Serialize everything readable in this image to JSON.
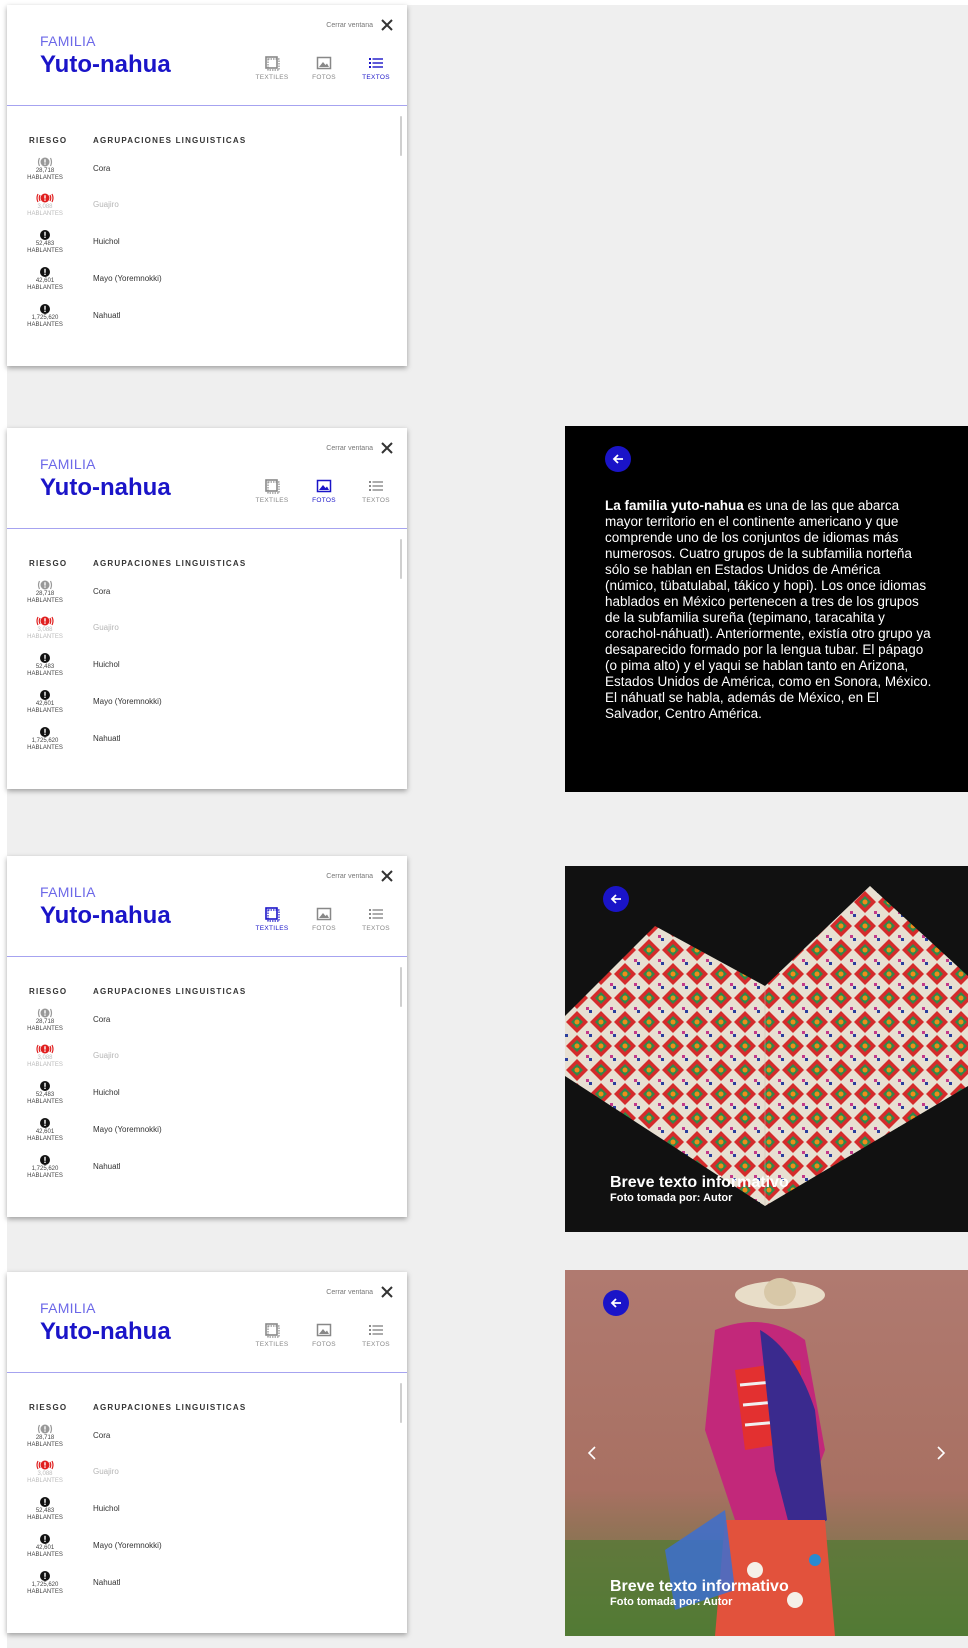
{
  "panel": {
    "family_label": "FAMILIA",
    "family_name": "Yuto-nahua",
    "close_label": "Cerrar ventana",
    "tabs": [
      {
        "label": "TEXTILES",
        "icon": "textile-icon"
      },
      {
        "label": "FOTOS",
        "icon": "photo-icon"
      },
      {
        "label": "TEXTOS",
        "icon": "list-icon"
      }
    ],
    "col_riesgo": "RIESGO",
    "col_agrupaciones": "AGRUPACIONES LINGUISTICAS",
    "rows": [
      {
        "speakers": "28,718",
        "unit": "HABLANTES",
        "language": "Cora",
        "risk_icon": "gray-alert-icon"
      },
      {
        "speakers": "3,088",
        "unit": "HABLANTES",
        "language": "Guajiro",
        "risk_icon": "red-alert-icon"
      },
      {
        "speakers": "52,483",
        "unit": "HABLANTES",
        "language": "Huichol",
        "risk_icon": "black-alert-icon"
      },
      {
        "speakers": "42,601",
        "unit": "HABLANTES",
        "language": "Mayo (Yoremnokki)",
        "risk_icon": "black-alert-icon"
      },
      {
        "speakers": "1,725,620",
        "unit": "HABLANTES",
        "language": "Nahuatl",
        "risk_icon": "black-alert-icon"
      }
    ]
  },
  "panel_active_tabs": [
    "TEXTOS",
    "FOTOS",
    "TEXTILES",
    "none"
  ],
  "info_card": {
    "bold_lead": "La familia yuto-nahua",
    "body": " es una de las que abarca mayor territorio en el continente americano y que comprende uno de los conjuntos de idiomas más numerosos. Cuatro grupos de la subfamilia norteña sólo se hablan en Estados Unidos de América (númico, tübatulabal, tákico y hopi). Los once idiomas hablados en México pertenecen a tres de los grupos de la subfamilia sureña (tepimano, taracahita y corachol-náhuatl). Anteriormente, existía otro grupo ya desaparecido formado por la lengua tubar. El pápago (o pima alto) y el yaqui se hablan tanto en Arizona, Estados Unidos de América, como en Sonora, México. El náhuatl se habla, además de México, en El Salvador, Centro América."
  },
  "photo_cards": [
    {
      "title": "Breve texto informativo",
      "subtitle": "Foto tomada por: Autor"
    },
    {
      "title": "Breve texto informativo",
      "subtitle": "Foto tomada por: Autor"
    }
  ],
  "colors": {
    "accent": "#1a14c8",
    "accent_light": "#6c68e8",
    "danger": "#e02020"
  }
}
